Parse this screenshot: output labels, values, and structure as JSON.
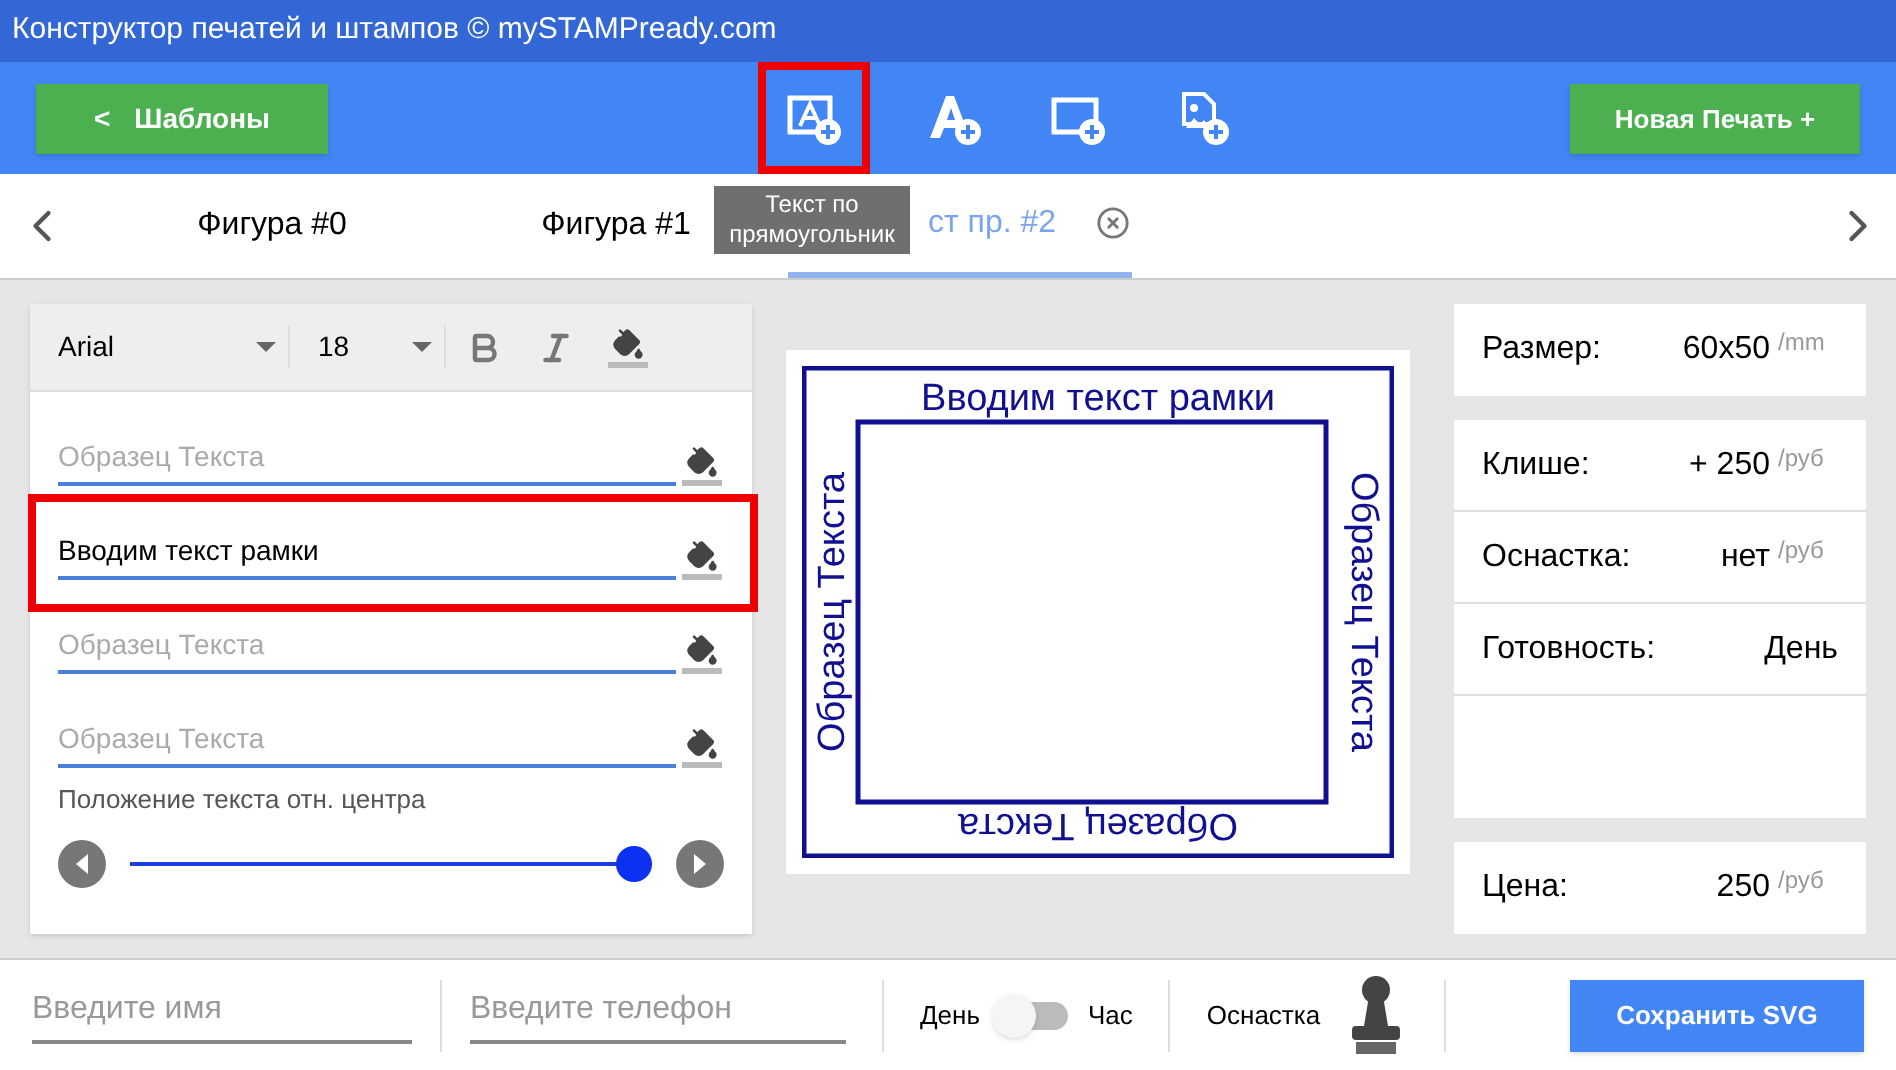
{
  "window": {
    "title": "Конструктор печатей и штампов © mySTAMPready.com"
  },
  "toolbar": {
    "back_button": {
      "icon": "<",
      "label": "Шаблоны"
    },
    "tools": [
      {
        "kind": "text-rect",
        "selected": true
      },
      {
        "kind": "text",
        "selected": false
      },
      {
        "kind": "rect",
        "selected": false
      },
      {
        "kind": "image",
        "selected": false
      }
    ],
    "new_button": "Новая Печать +"
  },
  "tooltip": {
    "lines": [
      "Текст по",
      "прямоугольник"
    ]
  },
  "tabs": [
    {
      "label": "Фигура #0",
      "selected": false,
      "closable": false
    },
    {
      "label": "Фигура #1",
      "selected": false,
      "closable": false
    },
    {
      "label": "ст пр. #2",
      "selected": true,
      "closable": true
    }
  ],
  "editor": {
    "font": "Arial",
    "size": "18",
    "fields": [
      {
        "placeholder": "Образец Текста",
        "highlighted": false
      },
      {
        "value": "Вводим текст рамки",
        "highlighted": true
      },
      {
        "placeholder": "Образец Текста",
        "highlighted": false
      },
      {
        "placeholder": "Образец Текста",
        "highlighted": false
      }
    ],
    "slider_label": "Положение текста отн. центра",
    "slider": {
      "level": 1
    }
  },
  "preview": {
    "top": "Вводим текст рамки",
    "left": "Образец Текста",
    "right": "Образец Текста",
    "bottom": "Образец Текста"
  },
  "info": {
    "size": {
      "label": "Размер:",
      "value": "60x50",
      "unit": "/mm"
    },
    "rows": [
      {
        "label": "Клише:",
        "value": "+ 250",
        "unit": "/руб"
      },
      {
        "label": "Оснастка:",
        "value": "нет",
        "unit": "/руб"
      },
      {
        "label": "Готовность:",
        "value": "День"
      }
    ],
    "price": {
      "label": "Цена:",
      "value": "250",
      "unit": "/руб"
    }
  },
  "footer": {
    "name_placeholder": "Введите имя",
    "phone_placeholder": "Введите телефон",
    "toggle": {
      "left": "День",
      "right": "Час",
      "on": false
    },
    "mount_label": "Оснастка",
    "save_button": "Сохранить SVG"
  }
}
